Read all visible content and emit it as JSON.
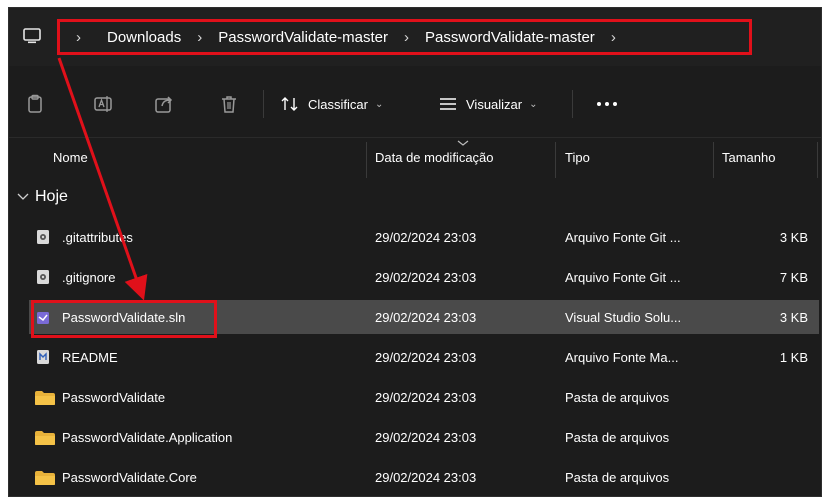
{
  "breadcrumb": {
    "items": [
      "Downloads",
      "PasswordValidate-master",
      "PasswordValidate-master"
    ]
  },
  "toolbar": {
    "icons": [
      "paste-icon",
      "rename-icon",
      "share-icon",
      "delete-icon"
    ],
    "sort_label": "Classificar",
    "view_label": "Visualizar",
    "more_label": "..."
  },
  "columns": {
    "name": "Nome",
    "modified": "Data de modificação",
    "type": "Tipo",
    "size": "Tamanho"
  },
  "group": {
    "label": "Hoje"
  },
  "rows": [
    {
      "name": ".gitattributes",
      "date": "29/02/2024 23:03",
      "type": "Arquivo Fonte Git ...",
      "size": "3 KB",
      "icon": "git-file-icon"
    },
    {
      "name": ".gitignore",
      "date": "29/02/2024 23:03",
      "type": "Arquivo Fonte Git ...",
      "size": "7 KB",
      "icon": "git-file-icon"
    },
    {
      "name": "PasswordValidate.sln",
      "date": "29/02/2024 23:03",
      "type": "Visual Studio Solu...",
      "size": "3 KB",
      "icon": "visual-studio-solution-icon"
    },
    {
      "name": "README",
      "date": "29/02/2024 23:03",
      "type": "Arquivo Fonte Ma...",
      "size": "1 KB",
      "icon": "markdown-file-icon"
    },
    {
      "name": "PasswordValidate",
      "date": "29/02/2024 23:03",
      "type": "Pasta de arquivos",
      "size": "",
      "icon": "folder-icon"
    },
    {
      "name": "PasswordValidate.Application",
      "date": "29/02/2024 23:03",
      "type": "Pasta de arquivos",
      "size": "",
      "icon": "folder-icon"
    },
    {
      "name": "PasswordValidate.Core",
      "date": "29/02/2024 23:03",
      "type": "Pasta de arquivos",
      "size": "",
      "icon": "folder-icon"
    }
  ],
  "colors": {
    "annotation": "#e0101a",
    "background": "#1c1c1c",
    "selected_row": "#4a4a4a",
    "folder": "#f4c247"
  }
}
